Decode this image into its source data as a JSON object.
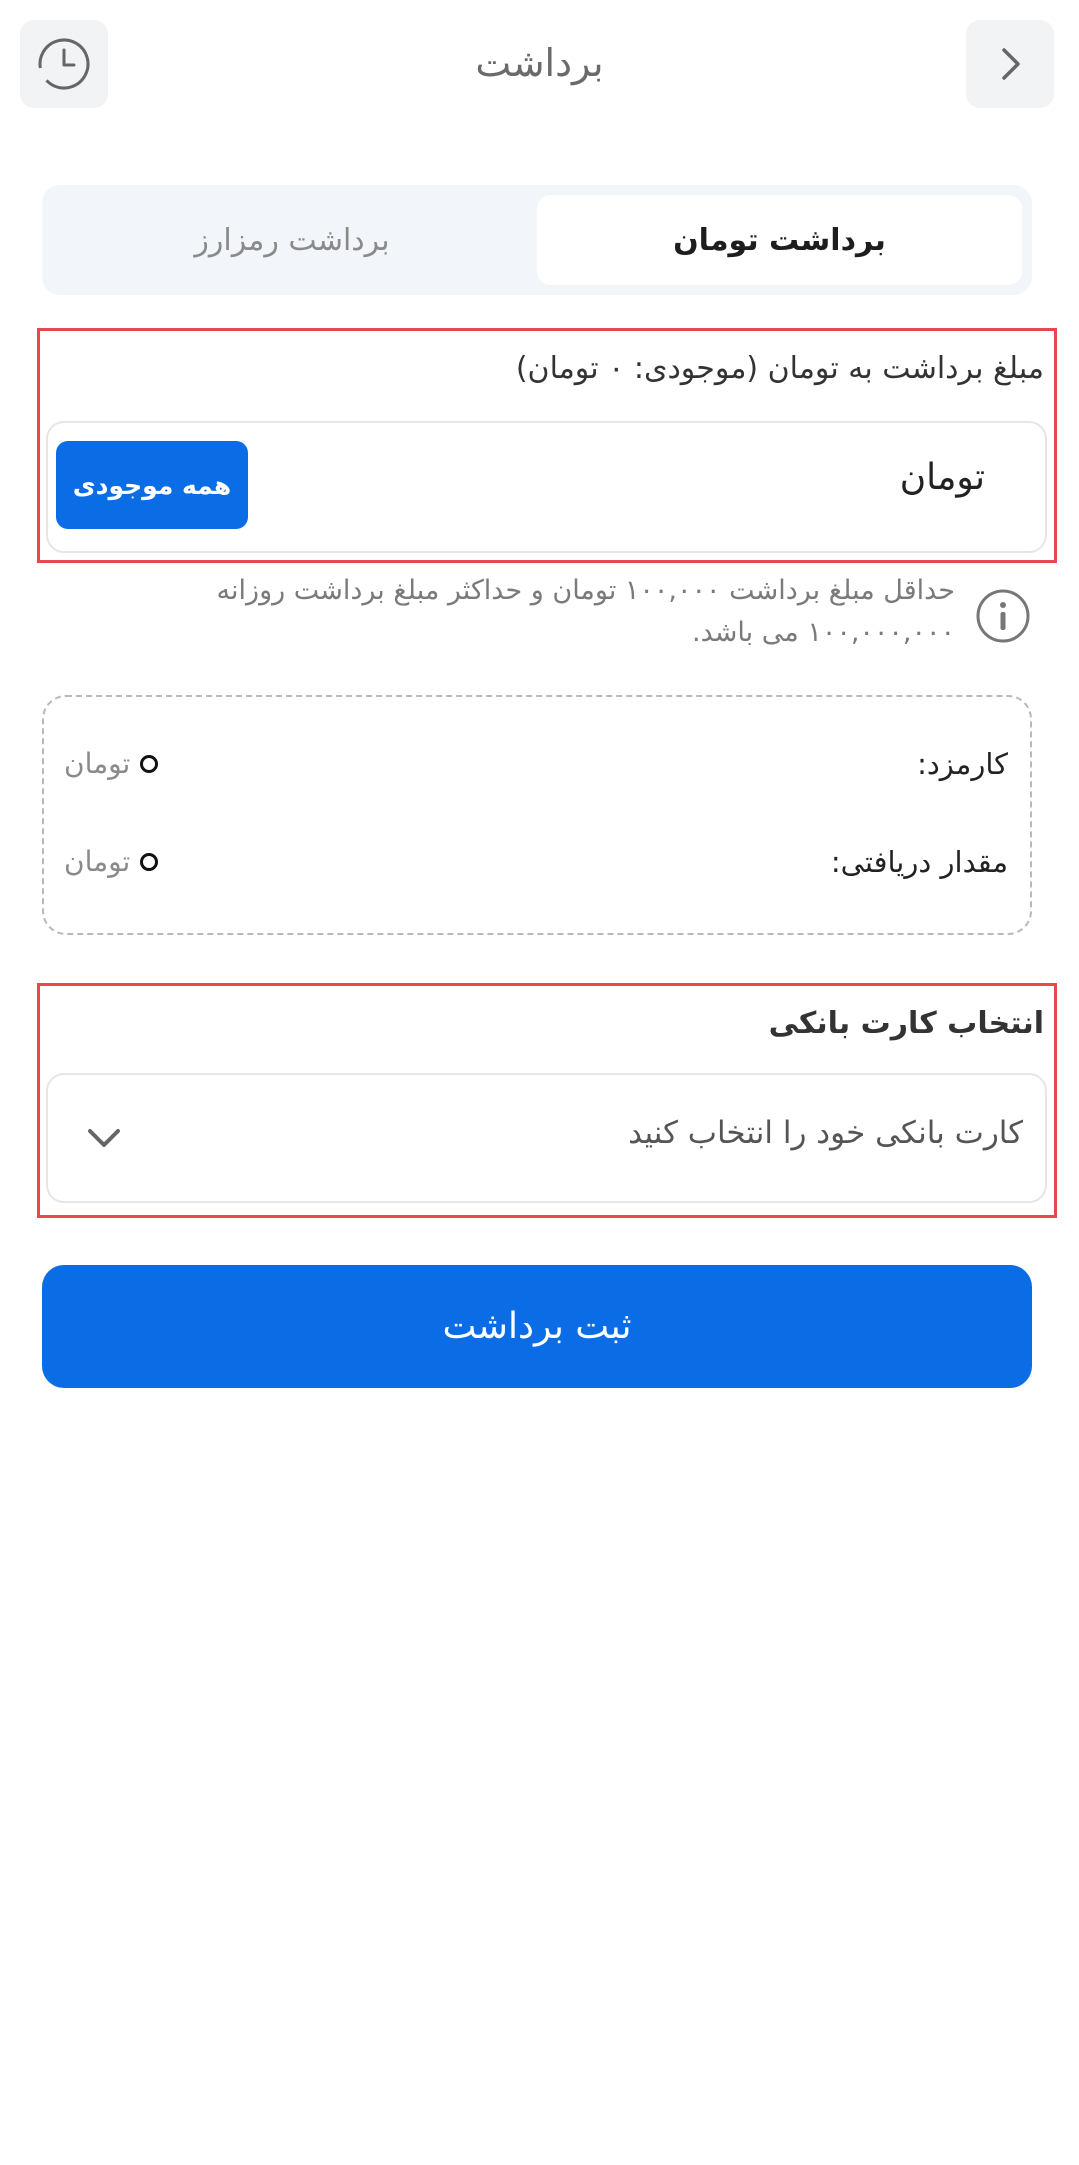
{
  "header": {
    "title": "برداشت",
    "history_icon": "history-clock-icon",
    "back_icon": "chevron-right-icon"
  },
  "tabs": [
    {
      "label": "برداشت تومان",
      "active": true
    },
    {
      "label": "برداشت رمزارز",
      "active": false
    }
  ],
  "amount": {
    "label": "مبلغ برداشت به تومان (موجودی: ۰ تومان)",
    "unit": "تومان",
    "value": "",
    "max_button": "همه موجودی"
  },
  "info": {
    "line1": "حداقل مبلغ برداشت ۱۰۰,۰۰۰ تومان و حداکثر مبلغ برداشت روزانه",
    "line2": "۱۰۰,۰۰۰,۰۰۰ می باشد."
  },
  "summary": {
    "fee_label": "کارمزد:",
    "fee_value": "0",
    "fee_unit": "تومان",
    "received_label": "مقدار دریافتی:",
    "received_value": "0",
    "received_unit": "تومان"
  },
  "bank_card": {
    "label": "انتخاب کارت بانکی",
    "placeholder": "کارت بانکی خود را انتخاب کنید"
  },
  "submit": {
    "label": "ثبت برداشت"
  },
  "colors": {
    "primary": "#0a6de6",
    "highlight": "#e5484d",
    "tabs_bg": "#f2f6fb"
  }
}
